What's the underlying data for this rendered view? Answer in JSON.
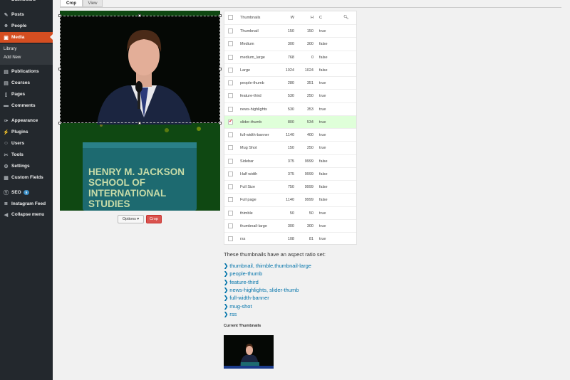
{
  "sidebar": {
    "items": [
      {
        "label": "Dashboard",
        "icon": "dashboard-icon",
        "glyph": "◔"
      },
      {
        "label": "Posts",
        "icon": "pin-icon",
        "glyph": "✎"
      },
      {
        "label": "People",
        "icon": "people-icon",
        "glyph": "☻"
      },
      {
        "label": "Media",
        "icon": "media-icon",
        "glyph": "▣"
      },
      {
        "label": "Publications",
        "icon": "publications-icon",
        "glyph": "▤"
      },
      {
        "label": "Courses",
        "icon": "courses-icon",
        "glyph": "▤"
      },
      {
        "label": "Pages",
        "icon": "pages-icon",
        "glyph": "▯"
      },
      {
        "label": "Comments",
        "icon": "comments-icon",
        "glyph": "▬"
      },
      {
        "label": "Appearance",
        "icon": "appearance-icon",
        "glyph": "✑"
      },
      {
        "label": "Plugins",
        "icon": "plugins-icon",
        "glyph": "⚡"
      },
      {
        "label": "Users",
        "icon": "users-icon",
        "glyph": "☺"
      },
      {
        "label": "Tools",
        "icon": "tools-icon",
        "glyph": "✂"
      },
      {
        "label": "Settings",
        "icon": "settings-icon",
        "glyph": "⚙"
      },
      {
        "label": "Custom Fields",
        "icon": "custom-fields-icon",
        "glyph": "▦"
      },
      {
        "label": "SEO",
        "icon": "seo-icon",
        "glyph": "Ⓨ",
        "badge": "5"
      },
      {
        "label": "Instagram Feed",
        "icon": "instagram-icon",
        "glyph": "◙"
      },
      {
        "label": "Collapse menu",
        "icon": "collapse-icon",
        "glyph": "◀"
      }
    ],
    "submenu": [
      "Library",
      "Add New"
    ],
    "active_color": "#d54e21"
  },
  "tabs": [
    "Crop",
    "View"
  ],
  "buttons": {
    "options": "Options ▾",
    "crop": "Crop"
  },
  "table": {
    "headers": {
      "name": "Thumbnails",
      "w": "W",
      "h": "H",
      "c": "C"
    },
    "rows": [
      {
        "name": "Thumbnail",
        "w": "150",
        "h": "150",
        "c": "true",
        "checked": false
      },
      {
        "name": "Medium",
        "w": "300",
        "h": "300",
        "c": "false",
        "checked": false
      },
      {
        "name": "medium_large",
        "w": "768",
        "h": "0",
        "c": "false",
        "checked": false
      },
      {
        "name": "Large",
        "w": "1024",
        "h": "1024",
        "c": "false",
        "checked": false
      },
      {
        "name": "people-thumb",
        "w": "280",
        "h": "351",
        "c": "true",
        "checked": false
      },
      {
        "name": "feature-third",
        "w": "530",
        "h": "250",
        "c": "true",
        "checked": false
      },
      {
        "name": "news-highlights",
        "w": "530",
        "h": "353",
        "c": "true",
        "checked": false
      },
      {
        "name": "slider-thumb",
        "w": "800",
        "h": "534",
        "c": "true",
        "checked": true
      },
      {
        "name": "full-width-banner",
        "w": "1140",
        "h": "400",
        "c": "true",
        "checked": false
      },
      {
        "name": "Mug Shot",
        "w": "150",
        "h": "250",
        "c": "true",
        "checked": false
      },
      {
        "name": "Sidebar",
        "w": "375",
        "h": "9999",
        "c": "false",
        "checked": false
      },
      {
        "name": "Half width",
        "w": "375",
        "h": "9999",
        "c": "false",
        "checked": false
      },
      {
        "name": "Full Size",
        "w": "750",
        "h": "9999",
        "c": "false",
        "checked": false
      },
      {
        "name": "Full page",
        "w": "1140",
        "h": "9999",
        "c": "false",
        "checked": false
      },
      {
        "name": "thimble",
        "w": "50",
        "h": "50",
        "c": "true",
        "checked": false
      },
      {
        "name": "thumbnail-large",
        "w": "300",
        "h": "300",
        "c": "true",
        "checked": false
      },
      {
        "name": "rss",
        "w": "108",
        "h": "81",
        "c": "true",
        "checked": false
      }
    ]
  },
  "aspect": {
    "title": "These thumbnails have an aspect ratio set:",
    "links": [
      "thumbnail, thimble,thumbnail-large",
      "people-thumb",
      "feature-third",
      "news-highlights, slider-thumb",
      "full-width-banner",
      "mug-shot",
      "rss"
    ]
  },
  "current_thumbnails_title": "Current Thumbnails",
  "image": {
    "podium_text": [
      "HENRY M. JACKSON",
      "SCHOOL OF",
      "INTERNATIONAL",
      "STUDIES"
    ]
  }
}
